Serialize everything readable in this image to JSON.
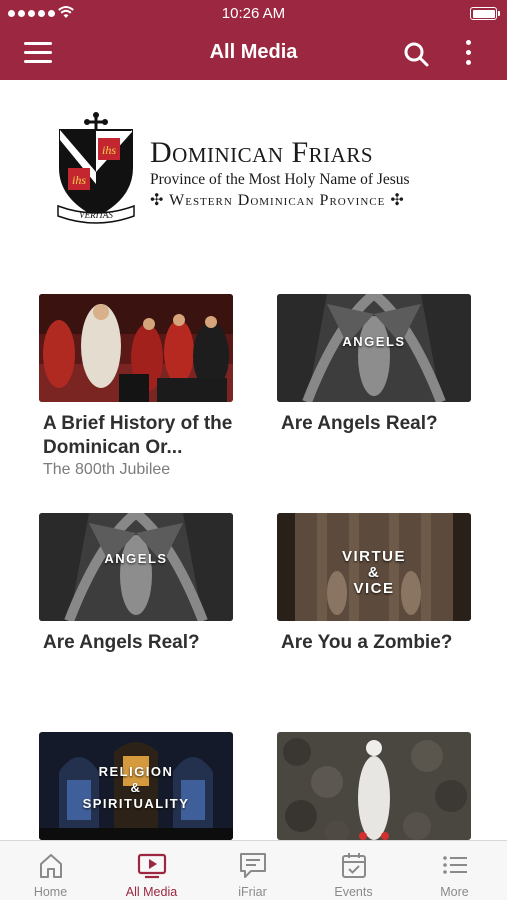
{
  "status_bar": {
    "time": "10:26 AM"
  },
  "header": {
    "title": "All Media"
  },
  "logo": {
    "name": "Dominican Friars",
    "line1": "Province of the Most Holy Name of Jesus",
    "line2": "✣ Western Dominican Province ✣",
    "emblem_text": [
      "ihs",
      "ihs",
      "VERITAS"
    ]
  },
  "media": [
    {
      "title": "A Brief History of the Dominican Or...",
      "subtitle": "The 800th Jubilee",
      "thumb_text": ""
    },
    {
      "title": "Are Angels Real?",
      "subtitle": "",
      "thumb_text": "ANGELS"
    },
    {
      "title": "Are Angels Real?",
      "subtitle": "",
      "thumb_text": "ANGELS"
    },
    {
      "title": "Are You a Zombie?",
      "subtitle": "",
      "thumb_text": "VIRTUE & VICE"
    },
    {
      "title": "",
      "subtitle": "",
      "thumb_text": "RELIGION & SPIRITUALITY"
    },
    {
      "title": "",
      "subtitle": "",
      "thumb_text": ""
    }
  ],
  "tabs": [
    {
      "label": "Home",
      "icon": "home-icon",
      "active": false
    },
    {
      "label": "All Media",
      "icon": "tv-play-icon",
      "active": true
    },
    {
      "label": "iFriar",
      "icon": "chat-bubble-icon",
      "active": false
    },
    {
      "label": "Events",
      "icon": "calendar-icon",
      "active": false
    },
    {
      "label": "More",
      "icon": "list-icon",
      "active": false
    }
  ],
  "colors": {
    "brand": "#9b2740",
    "tab_inactive": "#8a8a8a",
    "text": "#2f2f2f",
    "subtext": "#7c7c7c"
  }
}
